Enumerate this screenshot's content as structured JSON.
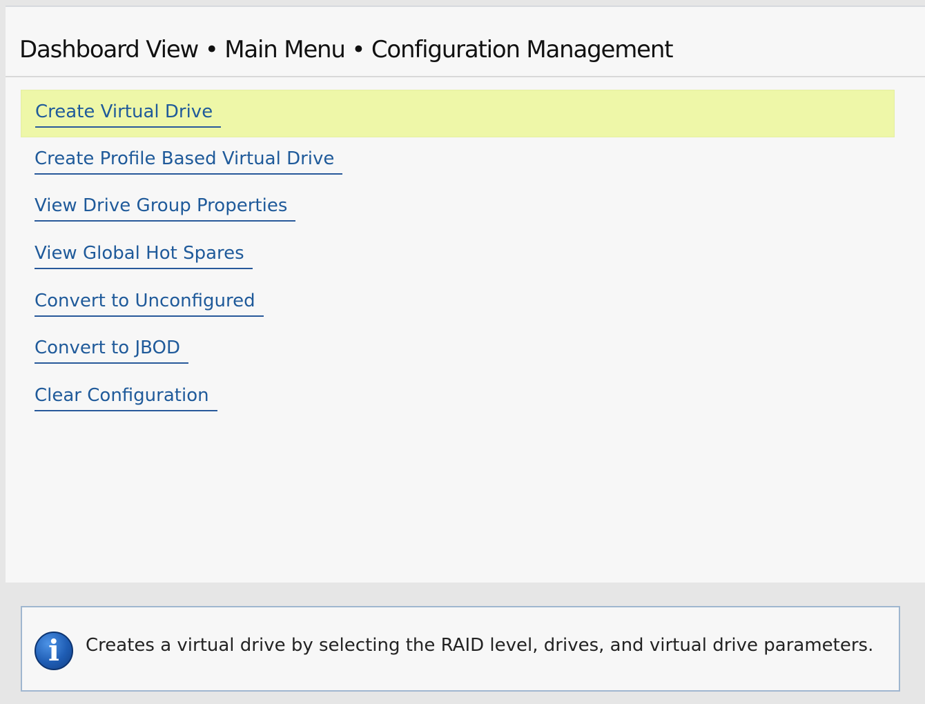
{
  "header": {
    "breadcrumb": "Dashboard View • Main Menu • Configuration Management"
  },
  "menu": {
    "items": [
      {
        "label": "Create Virtual Drive",
        "selected": true
      },
      {
        "label": "Create Profile Based Virtual Drive",
        "selected": false
      },
      {
        "label": "View Drive Group Properties",
        "selected": false
      },
      {
        "label": "View Global Hot Spares",
        "selected": false
      },
      {
        "label": "Convert to Unconfigured",
        "selected": false
      },
      {
        "label": "Convert to JBOD",
        "selected": false
      },
      {
        "label": "Clear Configuration",
        "selected": false
      }
    ]
  },
  "help": {
    "icon": "info-icon",
    "icon_glyph": "i",
    "text": "Creates a virtual drive by selecting the RAID level, drives, and virtual drive parameters."
  },
  "colors": {
    "selected_highlight": "#eef7a8",
    "link": "#1f5a9a",
    "info_border": "#9fb6cf"
  }
}
